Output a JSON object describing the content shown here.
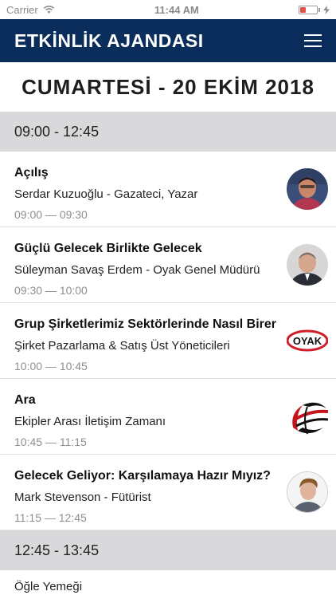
{
  "status_bar": {
    "carrier": "Carrier",
    "time": "11:44 AM",
    "battery_level": 0.35
  },
  "nav": {
    "title": "ETKİNLİK AJANDASI",
    "menu_icon": "hamburger-menu-icon"
  },
  "page": {
    "date_title": "CUMARTESİ - 20 EKİM 2018"
  },
  "blocks": [
    {
      "time_range": "09:00 - 12:45"
    },
    {
      "time_range": "12:45 - 13:45"
    }
  ],
  "sessions": [
    {
      "title": "Açılış",
      "speaker": "Serdar Kuzuoğlu - Gazateci, Yazar",
      "time": "09:00  —  09:30",
      "thumb": "speaker-photo"
    },
    {
      "title": "Güçlü Gelecek Birlikte Gelecek",
      "speaker": "Süleyman Savaş Erdem - Oyak Genel Müdürü",
      "time": "09:30  —  10:00",
      "thumb": "speaker-photo"
    },
    {
      "title": "Grup Şirketlerimiz Sektörlerinde Nasıl Birer Oyuncu",
      "speaker": "Şirket Pazarlama & Satış Üst Yöneticileri",
      "time": "10:00  —  10:45",
      "thumb": "oyak-logo",
      "logo_text": "OYAK"
    },
    {
      "title": "Ara",
      "speaker": "Ekipler Arası İletişim Zamanı",
      "time": "10:45  —  11:15",
      "thumb": "globe-logo"
    },
    {
      "title": "Gelecek Geliyor: Karşılamaya Hazır Mıyız?",
      "speaker": "Mark Stevenson - Fütürist",
      "time": "11:15  —  12:45",
      "thumb": "speaker-photo"
    }
  ],
  "lunch": {
    "title": "Öğle Yemeği"
  }
}
